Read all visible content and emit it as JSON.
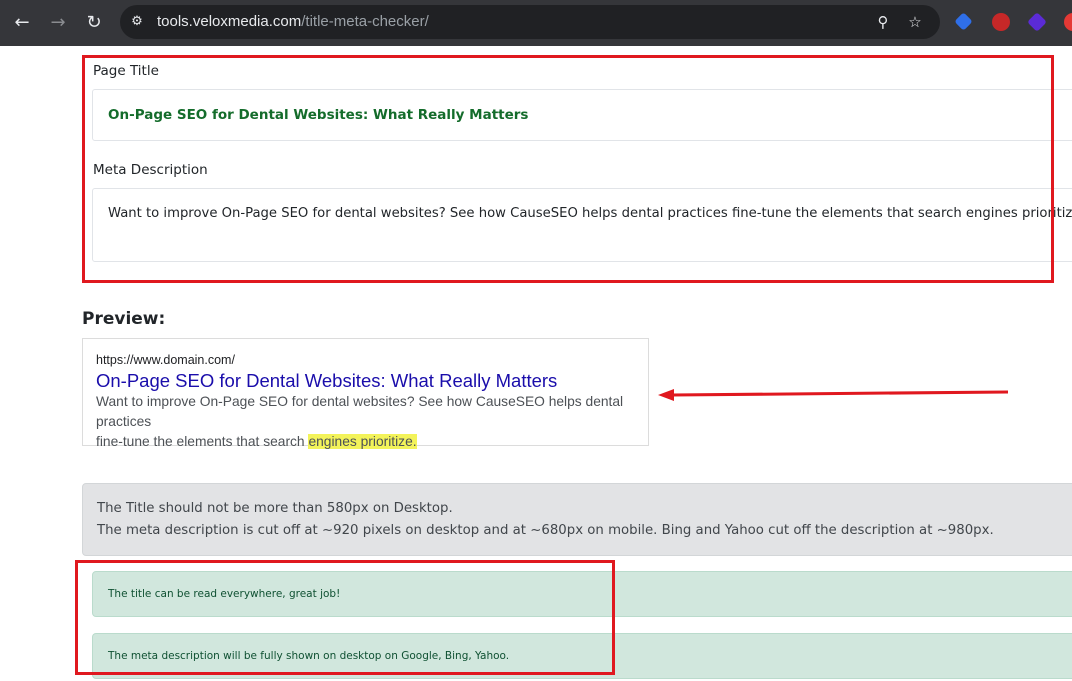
{
  "browser": {
    "url_host": "tools.veloxmedia.com",
    "url_path": "/title-meta-checker/",
    "extensions": [
      {
        "name": "tag-extension-icon",
        "color": "#2f6fe8"
      },
      {
        "name": "seo-extension-icon",
        "color": "#c62828"
      },
      {
        "name": "cube-extension-icon",
        "color": "#5b2bd6"
      },
      {
        "name": "red-extension-icon",
        "color": "#e53935"
      }
    ]
  },
  "form": {
    "title_label": "Page Title",
    "title_value": "On-Page SEO for Dental Websites: What Really Matters",
    "description_label": "Meta Description",
    "description_value": "Want to improve On-Page SEO for dental websites? See how CauseSEO helps dental practices fine-tune the elements that search engines prioritize."
  },
  "preview": {
    "heading": "Preview:",
    "url": "https://www.domain.com/",
    "title": "On-Page SEO for Dental Websites: What Really Matters",
    "desc_line1": "Want to improve On-Page SEO for dental websites? See how CauseSEO helps dental practices",
    "desc_line2_plain": "fine-tune the elements that search ",
    "desc_line2_highlight": "engines prioritize."
  },
  "info": {
    "line1": "The Title should not be more than 580px on Desktop.",
    "line2": "The meta description is cut off at ~920 pixels on desktop and at ~680px on mobile. Bing and Yahoo cut off the description at ~980px."
  },
  "results": {
    "title_ok": "The title can be read everywhere, great job!",
    "desc_ok": "The meta description will be fully shown on desktop on Google, Bing, Yahoo."
  },
  "colors": {
    "annotation": "#e0181f",
    "title_green": "#146c2b",
    "serp_link": "#1a0dab",
    "highlight": "#f3f35a"
  }
}
